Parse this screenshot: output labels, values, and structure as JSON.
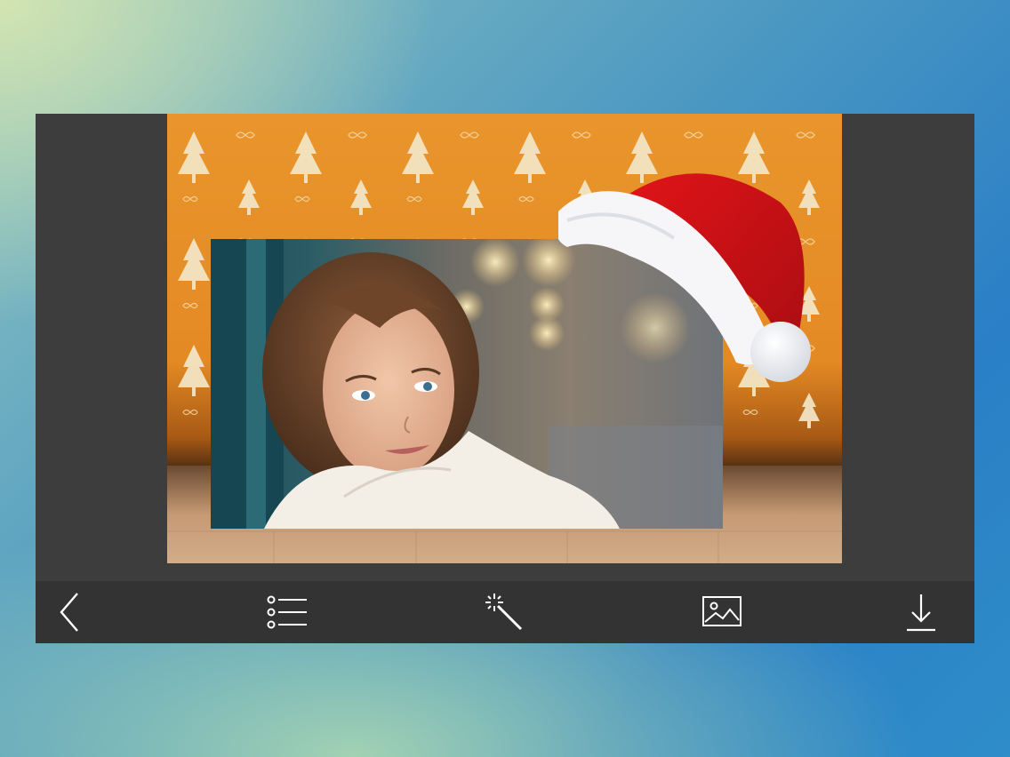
{
  "app": {
    "background_colors": [
      "#d6e6b0",
      "#4b98c2",
      "#2a7fc6"
    ],
    "panel_color": "#3d3d3d",
    "toolbar_color": "#333333"
  },
  "editor": {
    "frame_theme": "christmas-trees-orange",
    "frame_colors": {
      "orange": "#e8922a",
      "tree": "#f3e6c8",
      "floor": "#c8a27e"
    },
    "overlay_sticker": "santa-hat"
  },
  "toolbar": {
    "items": [
      {
        "icon": "back-chevron-icon"
      },
      {
        "icon": "list-icon"
      },
      {
        "icon": "magic-wand-icon"
      },
      {
        "icon": "image-icon"
      },
      {
        "icon": "download-icon"
      }
    ]
  }
}
